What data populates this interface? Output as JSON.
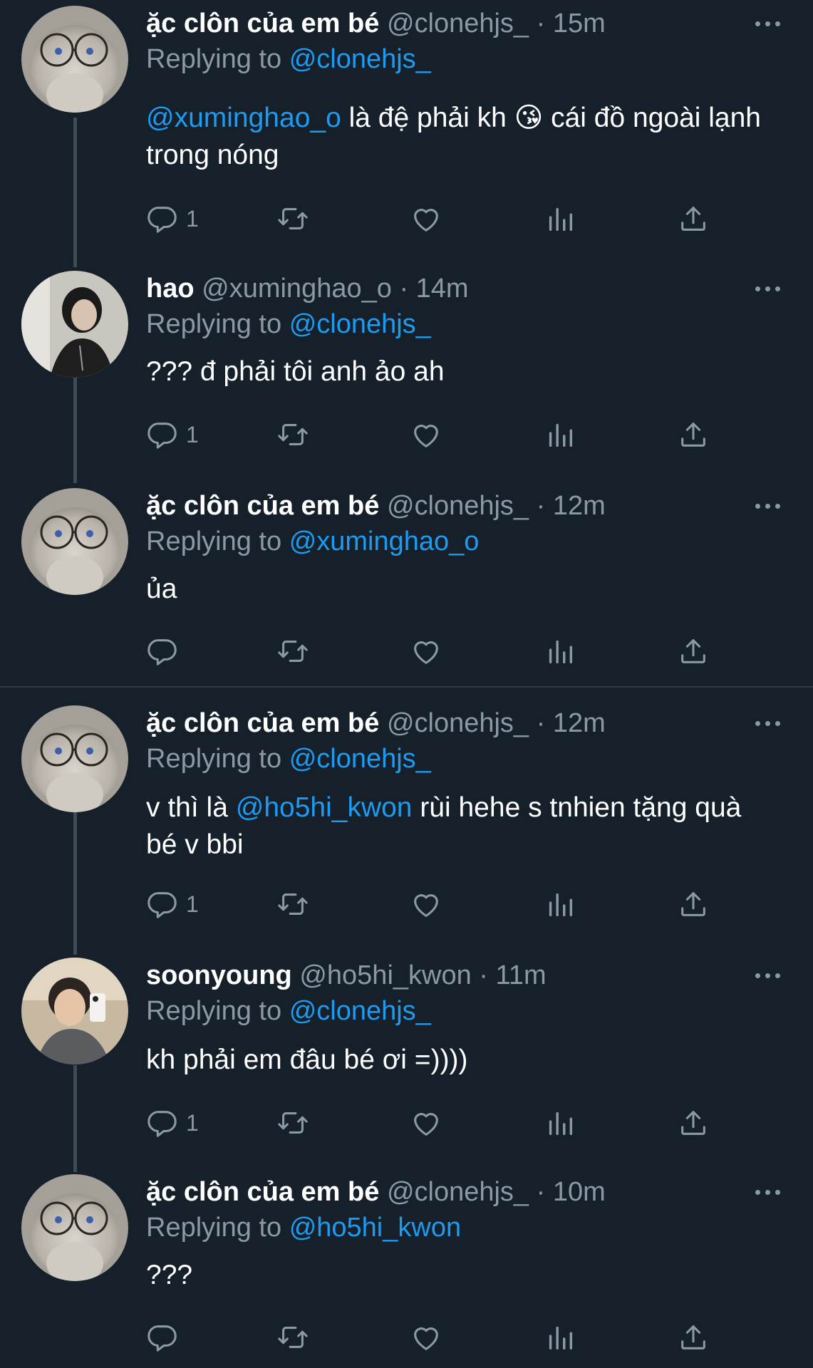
{
  "tweets": [
    {
      "name": "ặc clôn của em bé",
      "handle": "@clonehjs_",
      "sep": "·",
      "time": "15m",
      "replying_prefix": "Replying to",
      "replying_to": "@clonehjs_",
      "body_mention": "@xuminghao_o",
      "body_text_1": " là đệ phải kh 😘  cái đồ ngoài lạnh trong nóng",
      "reply_count": "1"
    },
    {
      "name": "hao",
      "handle": "@xuminghao_o",
      "sep": "·",
      "time": "14m",
      "replying_prefix": "Replying to",
      "replying_to": "@clonehjs_",
      "body_text_1": "??? đ phải tôi anh ảo ah",
      "reply_count": "1"
    },
    {
      "name": "ặc clôn của em bé",
      "handle": "@clonehjs_",
      "sep": "·",
      "time": "12m",
      "replying_prefix": "Replying to",
      "replying_to": "@xuminghao_o",
      "body_text_1": "ủa",
      "reply_count": ""
    },
    {
      "name": "ặc clôn của em bé",
      "handle": "@clonehjs_",
      "sep": "·",
      "time": "12m",
      "replying_prefix": "Replying to",
      "replying_to": "@clonehjs_",
      "body_text_1": "v thì là ",
      "body_mention": "@ho5hi_kwon",
      "body_text_2": " rùi hehe s tnhien tặng quà bé v bbi",
      "reply_count": "1"
    },
    {
      "name": "soonyoung",
      "handle": "@ho5hi_kwon",
      "sep": "·",
      "time": "11m",
      "replying_prefix": "Replying to",
      "replying_to": "@clonehjs_",
      "body_text_1": "kh phải em đâu bé ơi =))))",
      "reply_count": "1"
    },
    {
      "name": "ặc clôn của em bé",
      "handle": "@clonehjs_",
      "sep": "·",
      "time": "10m",
      "replying_prefix": "Replying to",
      "replying_to": "@ho5hi_kwon",
      "body_text_1": "???",
      "reply_count": ""
    }
  ],
  "icons": {
    "reply": "reply-icon",
    "retweet": "retweet-icon",
    "like": "heart-icon",
    "analytics": "analytics-icon",
    "share": "share-icon",
    "more": "more-icon"
  },
  "colors": {
    "background": "#15202b",
    "link": "#1d9bf0",
    "secondary_text": "#8b98a5",
    "thread_line": "#3d4b57"
  }
}
